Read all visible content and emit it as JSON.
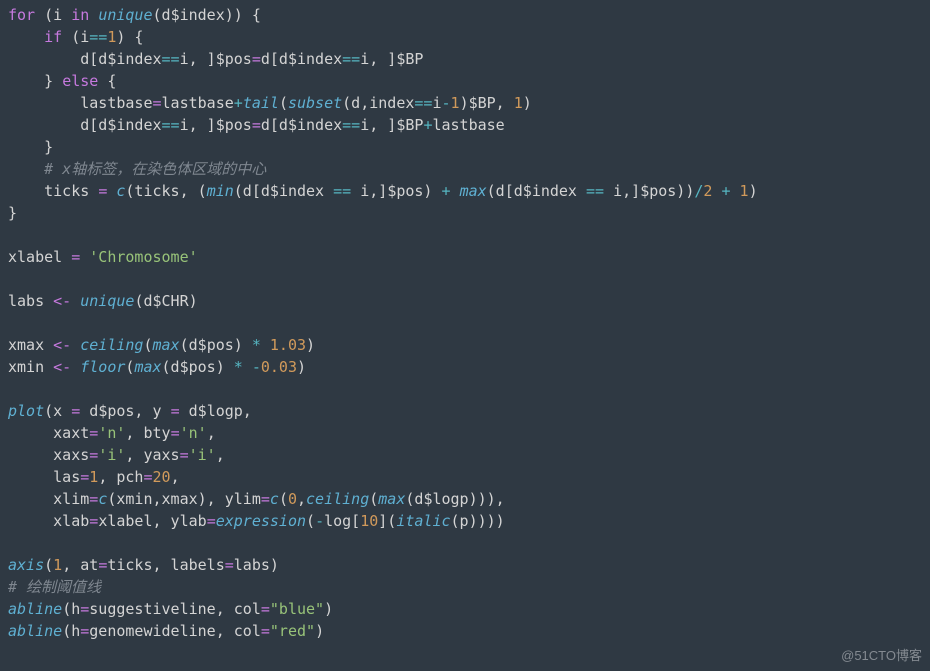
{
  "code": {
    "l1": {
      "a": "for",
      "b": " (i ",
      "c": "in",
      "d": " ",
      "e": "unique",
      "f": "(d",
      "g": "$",
      "h": "index)) {"
    },
    "l2": {
      "a": "    ",
      "b": "if",
      "c": " (i",
      "d": "==",
      "e": "1",
      "f": ") {"
    },
    "l3": {
      "a": "        d[d",
      "b": "$",
      "c": "index",
      "d": "==",
      "e": "i, ]",
      "f": "$",
      "g": "pos",
      "h": "=",
      "i": "d[d",
      "j": "$",
      "k": "index",
      "l": "==",
      "m": "i, ]",
      "n": "$",
      "o": "BP"
    },
    "l4": {
      "a": "    } ",
      "b": "else",
      "c": " {"
    },
    "l5": {
      "a": "        lastbase",
      "b": "=",
      "c": "lastbase",
      "d": "+",
      "e": "tail",
      "f": "(",
      "g": "subset",
      "h": "(d,index",
      "i": "==",
      "j": "i",
      "k": "-",
      "l": "1",
      "m": ")",
      "n": "$",
      "o": "BP, ",
      "p": "1",
      "q": ")"
    },
    "l6": {
      "a": "        d[d",
      "b": "$",
      "c": "index",
      "d": "==",
      "e": "i, ]",
      "f": "$",
      "g": "pos",
      "h": "=",
      "i": "d[d",
      "j": "$",
      "k": "index",
      "l": "==",
      "m": "i, ]",
      "n": "$",
      "o": "BP",
      "p": "+",
      "q": "lastbase"
    },
    "l7": {
      "a": "    }"
    },
    "l8": {
      "a": "    ",
      "b": "# x轴标签，在染色体区域的中心"
    },
    "l9": {
      "a": "    ticks ",
      "b": "=",
      "c": " ",
      "d": "c",
      "e": "(ticks, (",
      "f": "min",
      "g": "(d[d",
      "h": "$",
      "i": "index ",
      "j": "==",
      "k": " i,]",
      "l": "$",
      "m": "pos) ",
      "n": "+",
      "o": " ",
      "p": "max",
      "q": "(d[d",
      "r": "$",
      "s": "index ",
      "t": "==",
      "u": " i,]",
      "v": "$",
      "w": "pos))",
      "x": "/",
      "y": "2",
      "z": " ",
      "aa": "+",
      "ab": " ",
      "ac": "1",
      "ad": ")"
    },
    "l10": {
      "a": "}"
    },
    "l11": {
      "a": ""
    },
    "l12": {
      "a": "xlabel ",
      "b": "=",
      "c": " ",
      "d": "'Chromosome'"
    },
    "l13": {
      "a": ""
    },
    "l14": {
      "a": "labs ",
      "b": "<-",
      "c": " ",
      "d": "unique",
      "e": "(d",
      "f": "$",
      "g": "CHR)"
    },
    "l15": {
      "a": ""
    },
    "l16": {
      "a": "xmax ",
      "b": "<-",
      "c": " ",
      "d": "ceiling",
      "e": "(",
      "f": "max",
      "g": "(d",
      "h": "$",
      "i": "pos) ",
      "j": "*",
      "k": " ",
      "l": "1.03",
      "m": ")"
    },
    "l17": {
      "a": "xmin ",
      "b": "<-",
      "c": " ",
      "d": "floor",
      "e": "(",
      "f": "max",
      "g": "(d",
      "h": "$",
      "i": "pos) ",
      "j": "*",
      "k": " ",
      "l": "-",
      "m": "0.03",
      "n": ")"
    },
    "l18": {
      "a": ""
    },
    "l19": {
      "a": "plot",
      "b": "(x ",
      "c": "=",
      "d": " d",
      "e": "$",
      "f": "pos, y ",
      "g": "=",
      "h": " d",
      "i": "$",
      "j": "logp,"
    },
    "l20": {
      "a": "     xaxt",
      "b": "=",
      "c": "'n'",
      "d": ", bty",
      "e": "=",
      "f": "'n'",
      "g": ","
    },
    "l21": {
      "a": "     xaxs",
      "b": "=",
      "c": "'i'",
      "d": ", yaxs",
      "e": "=",
      "f": "'i'",
      "g": ","
    },
    "l22": {
      "a": "     las",
      "b": "=",
      "c": "1",
      "d": ", pch",
      "e": "=",
      "f": "20",
      "g": ","
    },
    "l23": {
      "a": "     xlim",
      "b": "=",
      "c": "c",
      "d": "(xmin,xmax), ylim",
      "e": "=",
      "f": "c",
      "g": "(",
      "h": "0",
      "i": ",",
      "j": "ceiling",
      "k": "(",
      "l": "max",
      "m": "(d",
      "n": "$",
      "o": "logp))),"
    },
    "l24": {
      "a": "     xlab",
      "b": "=",
      "c": "xlabel, ylab",
      "d": "=",
      "e": "expression",
      "f": "(",
      "g": "-",
      "h": "log[",
      "i": "10",
      "j": "](",
      "k": "italic",
      "l": "(p))))"
    },
    "l25": {
      "a": ""
    },
    "l26": {
      "a": "axis",
      "b": "(",
      "c": "1",
      "d": ", at",
      "e": "=",
      "f": "ticks, labels",
      "g": "=",
      "h": "labs)"
    },
    "l27": {
      "a": "# 绘制阈值线"
    },
    "l28": {
      "a": "abline",
      "b": "(h",
      "c": "=",
      "d": "suggestiveline, col",
      "e": "=",
      "f": "\"blue\"",
      "g": ")"
    },
    "l29": {
      "a": "abline",
      "b": "(h",
      "c": "=",
      "d": "genomewideline, col",
      "e": "=",
      "f": "\"red\"",
      "g": ")"
    }
  },
  "watermark": "@51CTO博客"
}
